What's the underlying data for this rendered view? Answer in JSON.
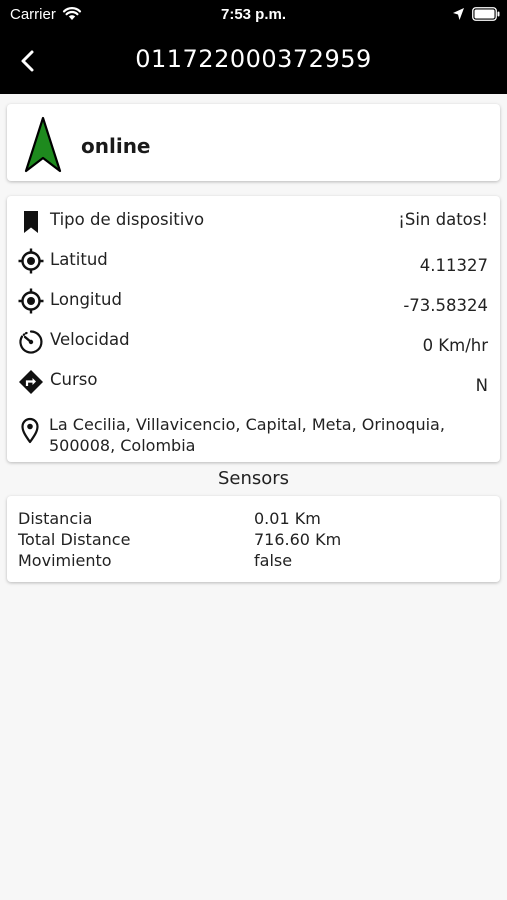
{
  "status_bar": {
    "carrier": "Carrier",
    "time": "7:53 p.m."
  },
  "nav": {
    "title": "011722000372959",
    "back_icon": "chevron-left-icon"
  },
  "device_status": {
    "label": "online",
    "icon": "navigation-arrow-icon",
    "icon_color": "#1e8a1e"
  },
  "info": [
    {
      "icon": "bookmark-icon",
      "label": "Tipo de dispositivo",
      "value": "¡Sin datos!"
    },
    {
      "icon": "gps-target-icon",
      "label": "Latitud",
      "value": "4.11327"
    },
    {
      "icon": "gps-target-icon",
      "label": "Longitud",
      "value": "-73.58324"
    },
    {
      "icon": "speedometer-icon",
      "label": "Velocidad",
      "value": "0 Km/hr"
    },
    {
      "icon": "direction-icon",
      "label": "Curso",
      "value": "N"
    }
  ],
  "address": {
    "icon": "map-pin-icon",
    "text": "La Cecilia, Villavicencio, Capital, Meta, Orinoquia, 500008, Colombia"
  },
  "sensors": {
    "heading": "Sensors",
    "items": [
      {
        "name": "Distancia",
        "value": "0.01 Km"
      },
      {
        "name": "Total Distance",
        "value": "716.60 Km"
      },
      {
        "name": "Movimiento",
        "value": "false"
      }
    ]
  }
}
